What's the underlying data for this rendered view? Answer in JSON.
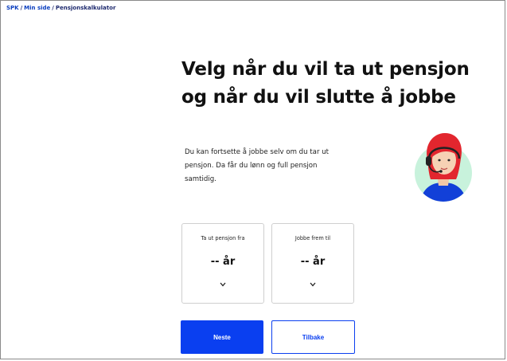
{
  "breadcrumb": {
    "items": [
      "SPK",
      "Min side",
      "Pensjonskalkulator"
    ],
    "separator": "/"
  },
  "page": {
    "title_line1": "Velg når du vil ta ut pensjon",
    "title_line2": "og når du vil slutte å jobbe",
    "intro_line1": "Du kan fortsette å jobbe selv om du tar ut",
    "intro_line2": "pensjon. Da får du lønn og full pensjon",
    "intro_line3": "samtidig."
  },
  "selectors": {
    "pension_start": {
      "label": "Ta ut pensjon fra",
      "value": "-- år",
      "icon": "chevron-down-icon"
    },
    "work_until": {
      "label": "Jobbe frem til",
      "value": "-- år",
      "icon": "chevron-down-icon"
    }
  },
  "buttons": {
    "next": "Neste",
    "back": "Tilbake"
  },
  "colors": {
    "primary": "#0a3ff0",
    "avatar_bg": "#c8f2dc",
    "avatar_hair": "#e2262e",
    "avatar_shirt": "#1240d8"
  }
}
